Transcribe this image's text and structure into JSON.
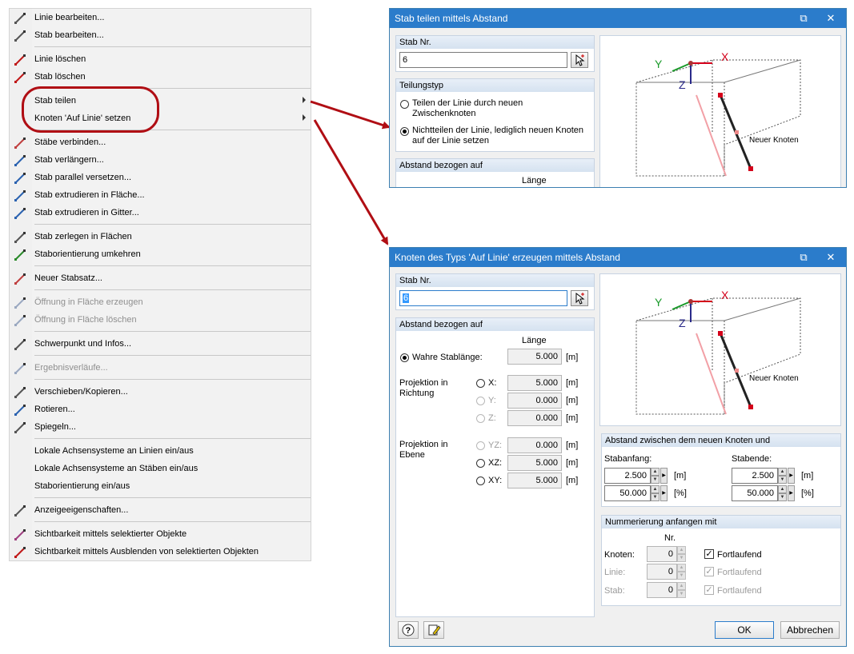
{
  "menu": {
    "items": [
      {
        "label": "Linie bearbeiten...",
        "icon": "edit-line-icon",
        "disabled": false
      },
      {
        "label": "Stab bearbeiten...",
        "icon": "edit-member-icon",
        "disabled": false
      },
      {
        "label": "Linie löschen",
        "icon": "delete-line-icon",
        "disabled": false
      },
      {
        "label": "Stab löschen",
        "icon": "delete-member-icon",
        "disabled": false
      },
      {
        "label": "Stab teilen",
        "icon": "",
        "disabled": false,
        "submenu": true
      },
      {
        "label": "Knoten 'Auf Linie' setzen",
        "icon": "",
        "disabled": false,
        "submenu": true
      },
      {
        "label": "Stäbe verbinden...",
        "icon": "connect-members-icon",
        "disabled": false
      },
      {
        "label": "Stab verlängern...",
        "icon": "extend-member-icon",
        "disabled": false
      },
      {
        "label": "Stab parallel versetzen...",
        "icon": "parallel-offset-icon",
        "disabled": false
      },
      {
        "label": "Stab extrudieren in Fläche...",
        "icon": "extrude-surface-icon",
        "disabled": false
      },
      {
        "label": "Stab extrudieren in Gitter...",
        "icon": "extrude-grid-icon",
        "disabled": false
      },
      {
        "label": "Stab zerlegen in Flächen",
        "icon": "decompose-icon",
        "disabled": false
      },
      {
        "label": "Staborientierung umkehren",
        "icon": "reverse-orientation-icon",
        "disabled": false
      },
      {
        "label": "Neuer Stabsatz...",
        "icon": "new-set-icon",
        "disabled": false
      },
      {
        "label": "Öffnung in Fläche erzeugen",
        "icon": "create-opening-icon",
        "disabled": true
      },
      {
        "label": "Öffnung in Fläche löschen",
        "icon": "delete-opening-icon",
        "disabled": true
      },
      {
        "label": "Schwerpunkt und Infos...",
        "icon": "centroid-icon",
        "disabled": false
      },
      {
        "label": "Ergebnisverläufe...",
        "icon": "result-diagram-icon",
        "disabled": true
      },
      {
        "label": "Verschieben/Kopieren...",
        "icon": "move-copy-icon",
        "disabled": false
      },
      {
        "label": "Rotieren...",
        "icon": "rotate-icon",
        "disabled": false
      },
      {
        "label": "Spiegeln...",
        "icon": "mirror-icon",
        "disabled": false
      },
      {
        "label": "Lokale Achsensysteme an Linien ein/aus",
        "icon": "",
        "disabled": false
      },
      {
        "label": "Lokale Achsensysteme an Stäben ein/aus",
        "icon": "",
        "disabled": false
      },
      {
        "label": "Staborientierung ein/aus",
        "icon": "",
        "disabled": false
      },
      {
        "label": "Anzeigeeigenschaften...",
        "icon": "display-properties-icon",
        "disabled": false
      },
      {
        "label": "Sichtbarkeit mittels selektierter Objekte",
        "icon": "visibility-selected-icon",
        "disabled": false
      },
      {
        "label": "Sichtbarkeit mittels Ausblenden von selektierten Objekten",
        "icon": "visibility-hide-icon",
        "disabled": false
      }
    ]
  },
  "dialog1": {
    "title": "Stab teilen mittels Abstand",
    "member_group": "Stab Nr.",
    "member_value": "6",
    "division_group": "Teilungstyp",
    "opt1_line1": "Teilen der Linie durch neuen",
    "opt1_line2": "Zwischenknoten",
    "opt2_line1": "Nichtteilen der Linie, lediglich neuen Knoten",
    "opt2_line2": "auf der Linie setzen",
    "distance_group": "Abstand bezogen auf",
    "length_header": "Länge",
    "fig_new_node": "Neuer Knoten"
  },
  "dialog2": {
    "title": "Knoten des Typs 'Auf Linie' erzeugen mittels Abstand",
    "member_group": "Stab Nr.",
    "member_value": "6",
    "distance_group": "Abstand bezogen auf",
    "length_header": "Länge",
    "true_length_label": "Wahre Stablänge:",
    "true_length_value": "5.000",
    "unit_m": "[m]",
    "unit_pct": "[%]",
    "proj_dir_line1": "Projektion in",
    "proj_dir_line2": "Richtung",
    "x_label": "X:",
    "x_value": "5.000",
    "y_label": "Y:",
    "y_value": "0.000",
    "z_label": "Z:",
    "z_value": "0.000",
    "proj_plane_line1": "Projektion in",
    "proj_plane_line2": "Ebene",
    "yz_label": "YZ:",
    "yz_value": "0.000",
    "xz_label": "XZ:",
    "xz_value": "5.000",
    "xy_label": "XY:",
    "xy_value": "5.000",
    "between_group": "Abstand zwischen dem neuen Knoten und",
    "start_label": "Stabanfang:",
    "end_label": "Stabende:",
    "start_m": "2.500",
    "start_pct": "50.000",
    "end_m": "2.500",
    "end_pct": "50.000",
    "numbering_group": "Nummerierung anfangen mit",
    "nr_header": "Nr.",
    "node_label": "Knoten:",
    "line_label": "Linie:",
    "member_label": "Stab:",
    "node_nr": "0",
    "line_nr": "0",
    "member_nr": "0",
    "continuous": "Fortlaufend",
    "ok": "OK",
    "cancel": "Abbrechen",
    "fig_new_node": "Neuer Knoten"
  },
  "axes": {
    "x": "X",
    "y": "Y",
    "z": "Z"
  },
  "colors": {
    "title_bar": "#2b7ccb",
    "highlight": "#b00e14",
    "arrow": "#b00e14"
  }
}
